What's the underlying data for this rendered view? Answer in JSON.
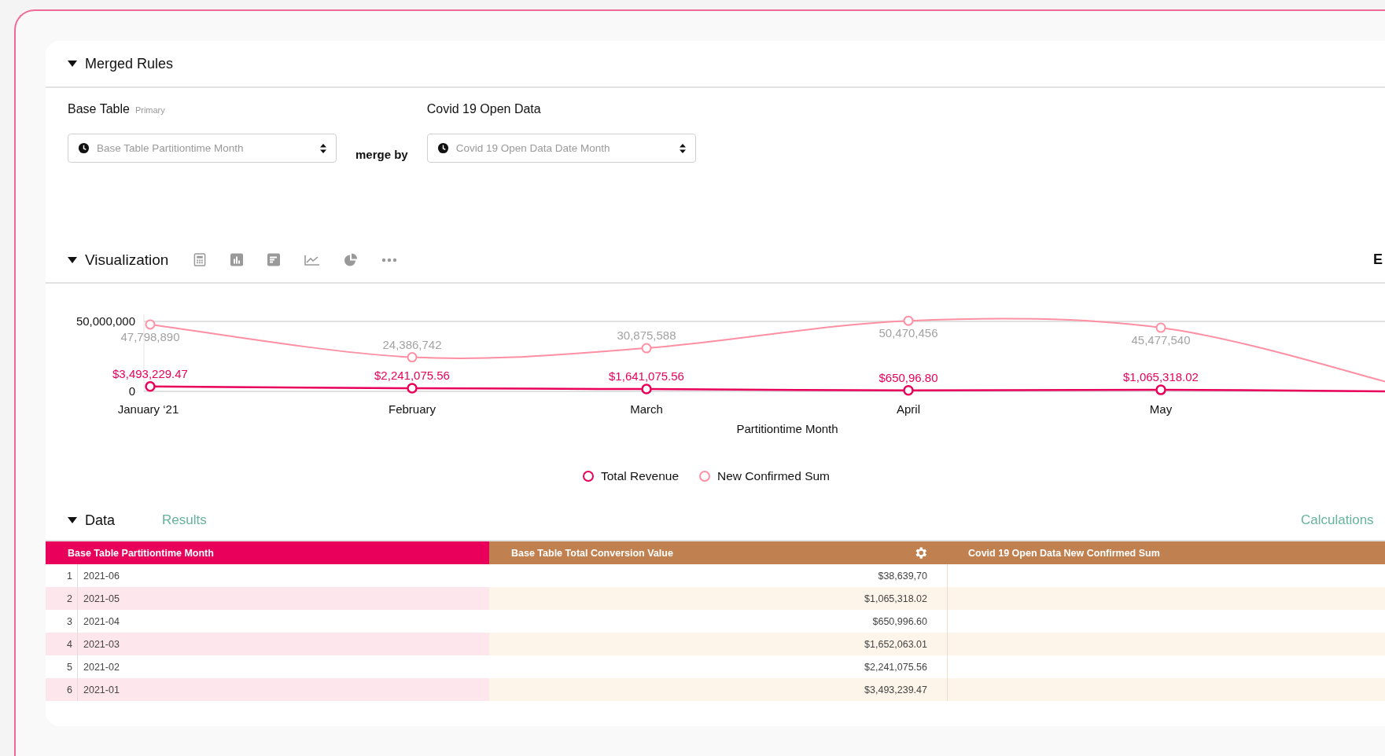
{
  "merged_rules": {
    "title": "Merged Rules",
    "base": {
      "label": "Base Table",
      "tag": "Primary",
      "placeholder": "Base Table Partitiontime Month"
    },
    "merge_label": "merge by",
    "other": {
      "label": "Covid 19 Open Data",
      "placeholder": "Covid 19 Open Data Date Month"
    }
  },
  "visualization": {
    "title": "Visualization",
    "edge_text": "E",
    "chart_data": {
      "type": "line",
      "xlabel": "Partitiontime Month",
      "categories": [
        "January ‘21",
        "February",
        "March",
        "April",
        "May"
      ],
      "ylim": [
        0,
        55000000
      ],
      "legend": "bottom",
      "yticks": [
        {
          "value": 0,
          "label": "0"
        },
        {
          "value": 50000000,
          "label": "50,000,000"
        }
      ],
      "series": [
        {
          "name": "Total Revenue",
          "color": "#e8005a",
          "marker": "circle",
          "values": [
            3493229.47,
            2241075.56,
            1641075.56,
            650996.8,
            1065318.02
          ],
          "value_labels": [
            "$3,493,229.47",
            "$2,241,075.56",
            "$1,641,075.56",
            "$650,96.80",
            "$1,065,318.02"
          ]
        },
        {
          "name": "New Confirmed Sum",
          "color": "#ff8fa3",
          "marker": "circle",
          "values": [
            47798890,
            24386742,
            30875588,
            50470456,
            45477540
          ],
          "value_labels": [
            "47,798,890",
            "24,386,742",
            "30,875,588",
            "50,470,456",
            "45,477,540"
          ]
        }
      ]
    }
  },
  "data": {
    "title": "Data",
    "results": "Results",
    "calculations": "Calculations",
    "table": {
      "columns": [
        {
          "label": "Base Table Partitiontime Month",
          "color": "#e8005a"
        },
        {
          "label": "Base Table Total Conversion Value",
          "color": "#c08050"
        },
        {
          "label": "Covid 19 Open Data New Confirmed Sum",
          "color": "#c08050"
        }
      ],
      "rows": [
        {
          "number": "1",
          "month": "2021-06",
          "value": "$38,639,70"
        },
        {
          "number": "2",
          "month": "2021-05",
          "value": "$1,065,318.02"
        },
        {
          "number": "3",
          "month": "2021-04",
          "value": "$650,996.60"
        },
        {
          "number": "4",
          "month": "2021-03",
          "value": "$1,652,063.01"
        },
        {
          "number": "5",
          "month": "2021-02",
          "value": "$2,241,075.56"
        },
        {
          "number": "6",
          "month": "2021-01",
          "value": "$3,493,239.47"
        }
      ]
    }
  }
}
